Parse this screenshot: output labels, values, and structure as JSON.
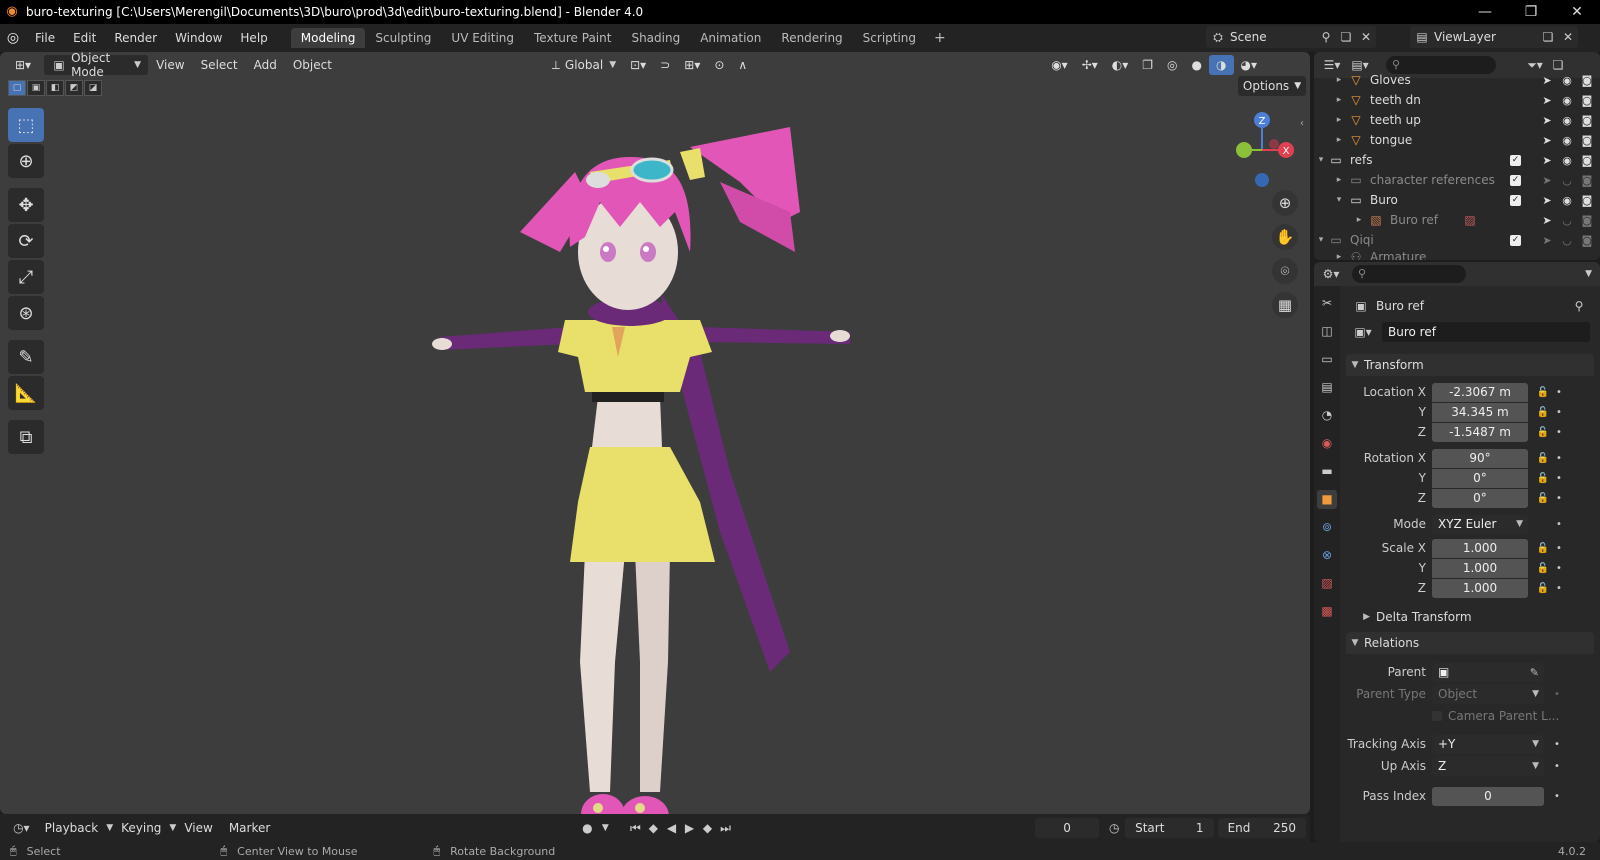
{
  "window": {
    "title": "buro-texturing [C:\\Users\\Merengil\\Documents\\3D\\buro\\prod\\3d\\edit\\buro-texturing.blend] - Blender 4.0",
    "minimize": "—",
    "maximize": "❐",
    "close": "✕"
  },
  "menus": [
    "File",
    "Edit",
    "Render",
    "Window",
    "Help"
  ],
  "workspaces": [
    "Modeling",
    "Sculpting",
    "UV Editing",
    "Texture Paint",
    "Shading",
    "Animation",
    "Rendering",
    "Scripting"
  ],
  "workspace_add": "+",
  "scene": {
    "label": "Scene"
  },
  "view_layer": {
    "label": "ViewLayer"
  },
  "viewport": {
    "mode": "Object Mode",
    "menus": [
      "View",
      "Select",
      "Add",
      "Object"
    ],
    "orientation": "Global",
    "options": "Options",
    "gizmo": {
      "z": "Z",
      "x": "X"
    }
  },
  "outliner": {
    "rows": [
      {
        "label": "Gloves",
        "dim": false
      },
      {
        "label": "teeth dn",
        "dim": false
      },
      {
        "label": "teeth up",
        "dim": false
      },
      {
        "label": "tongue",
        "dim": false
      },
      {
        "label": "refs",
        "dim": false
      },
      {
        "label": "character references",
        "dim": true
      },
      {
        "label": "Buro",
        "dim": false
      },
      {
        "label": "Buro ref",
        "dim": true
      },
      {
        "label": "Qiqi",
        "dim": true
      },
      {
        "label": "Armature",
        "dim": true
      }
    ]
  },
  "properties": {
    "object_name": "Buro ref",
    "data_name": "Buro ref",
    "transform": {
      "title": "Transform",
      "location_x_label": "Location X",
      "location_x": "-2.3067 m",
      "location_y": "34.345 m",
      "location_z": "-1.5487 m",
      "rotation_x_label": "Rotation X",
      "rotation_x": "90°",
      "rotation_y": "0°",
      "rotation_z": "0°",
      "mode_label": "Mode",
      "mode": "XYZ Euler",
      "scale_x_label": "Scale X",
      "scale_x": "1.000",
      "scale_y": "1.000",
      "scale_z": "1.000",
      "y": "Y",
      "z": "Z"
    },
    "delta_transform": "Delta Transform",
    "relations": {
      "title": "Relations",
      "parent_label": "Parent",
      "parent_type_label": "Parent Type",
      "parent_type": "Object",
      "camera_parent": "Camera Parent L...",
      "tracking_axis_label": "Tracking Axis",
      "tracking_axis": "+Y",
      "up_axis_label": "Up Axis",
      "up_axis": "Z",
      "pass_index_label": "Pass Index",
      "pass_index": "0"
    }
  },
  "timeline": {
    "menus": [
      "Playback",
      "Keying",
      "View",
      "Marker"
    ],
    "current_frame": "0",
    "start_label": "Start",
    "start": "1",
    "end_label": "End",
    "end": "250"
  },
  "status": {
    "select": "Select",
    "center_view": "Center View to Mouse",
    "rotate_bg": "Rotate Background",
    "version": "4.0.2"
  },
  "colors": {
    "accent": "#4772b3",
    "skirt": "#e8e06a",
    "hair": "#e256b8",
    "purple": "#6a2a78",
    "skin": "#e8dcd6"
  }
}
